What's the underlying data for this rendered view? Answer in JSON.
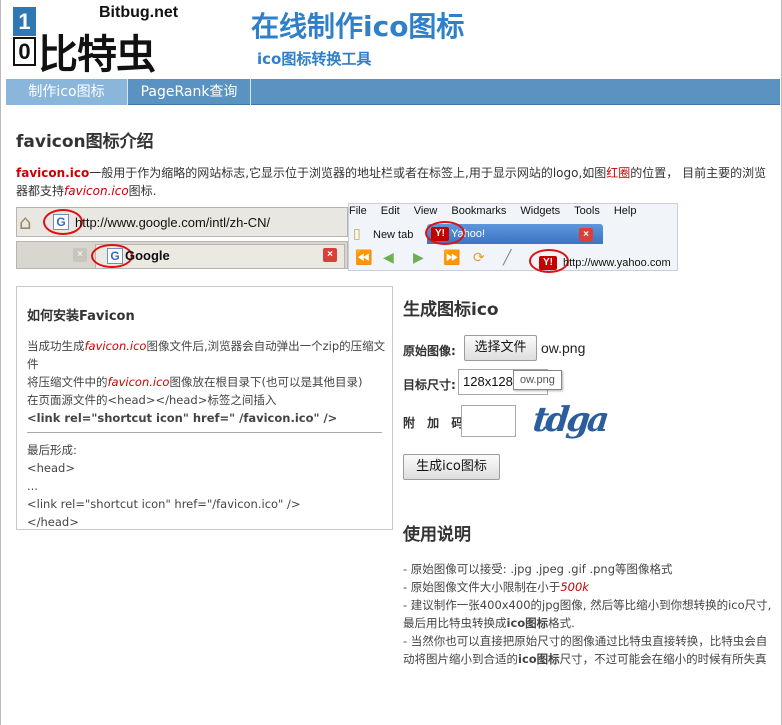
{
  "logo": {
    "digit_top": "1",
    "digit_bottom": "0",
    "site": "Bitbug.net",
    "name": "比特虫"
  },
  "header": {
    "title": "在线制作ico图标",
    "subtitle": "ico图标转换工具"
  },
  "nav": [
    {
      "label": "制作ico图标"
    },
    {
      "label": "PageRank查询"
    }
  ],
  "intro": {
    "heading": "favicon图标介绍",
    "term": "favicon.ico",
    "text_a": "一般用于作为缩略的网站标志,它显示位于浏览器的地址栏或者在标签上,用于显示网站的logo,如图",
    "red_circle": "红圈",
    "text_b": "的位置，  目前主要的浏览器都支持",
    "term_italic": "favicon.ico",
    "text_c": "图标."
  },
  "demo": {
    "ff_url": "http://www.google.com/intl/zh-CN/",
    "ff_tab": "Google",
    "ie_menu": [
      "File",
      "Edit",
      "View",
      "Bookmarks",
      "Widgets",
      "Tools",
      "Help"
    ],
    "ie_newtab": "New tab",
    "ie_tab": "Yahoo!",
    "ie_url": "http://www.yahoo.com"
  },
  "install": {
    "heading": "如何安装Favicon",
    "l1a": "当成功生成",
    "l1b": "favicon.ico",
    "l1c": "图像文件后,浏览器会自动弹出一个zip的压缩文件",
    "l2a": "将压缩文件中的",
    "l2b": "favicon.ico",
    "l2c": "图像放在根目录下(也可以是其他目录)",
    "l3": "在页面源文件的<head></head>标签之间插入",
    "code": "<link rel=\"shortcut icon\" href=\" /favicon.ico\" />",
    "result_label": "最后形成:",
    "r1": "<head>",
    "r2": "...",
    "r3": "<link rel=\"shortcut icon\" href=\"/favicon.ico\" />",
    "r4": "</head>"
  },
  "generate": {
    "heading": "生成图标ico",
    "source_label": "原始图像:",
    "choose_button": "选择文件",
    "file_name": "ow.png",
    "size_label": "目标尺寸:",
    "size_value": "128x128",
    "tooltip": "ow.png",
    "code_label": "附 加 码:",
    "code_value": "",
    "captcha": "tdga",
    "submit": "生成ico图标"
  },
  "usage": {
    "heading": "使用说明",
    "i1": "- 原始图像可以接受: .jpg .jpeg .gif .png等图像格式",
    "i2a": "- 原始图像文件大小限制在小于",
    "i2b": "500k",
    "i3a": "- 建议制作一张400x400的jpg图像, 然后等比缩小到你想转换的ico尺寸,最后用比特虫转换成",
    "i3b": "ico图标",
    "i3c": "格式.",
    "i4a": "- 当然你也可以直接把原始尺寸的图像通过比特虫直接转换，比特虫会自动将图片缩小到合适的",
    "i4b": "ico图标",
    "i4c": "尺寸，不过可能会在缩小的时候有所失真"
  },
  "colors": {
    "nav_bg": "#5a92c2",
    "nav_active": "#8bb6dc",
    "title_blue": "#2f80c8",
    "highlight_red": "#cc0000"
  }
}
